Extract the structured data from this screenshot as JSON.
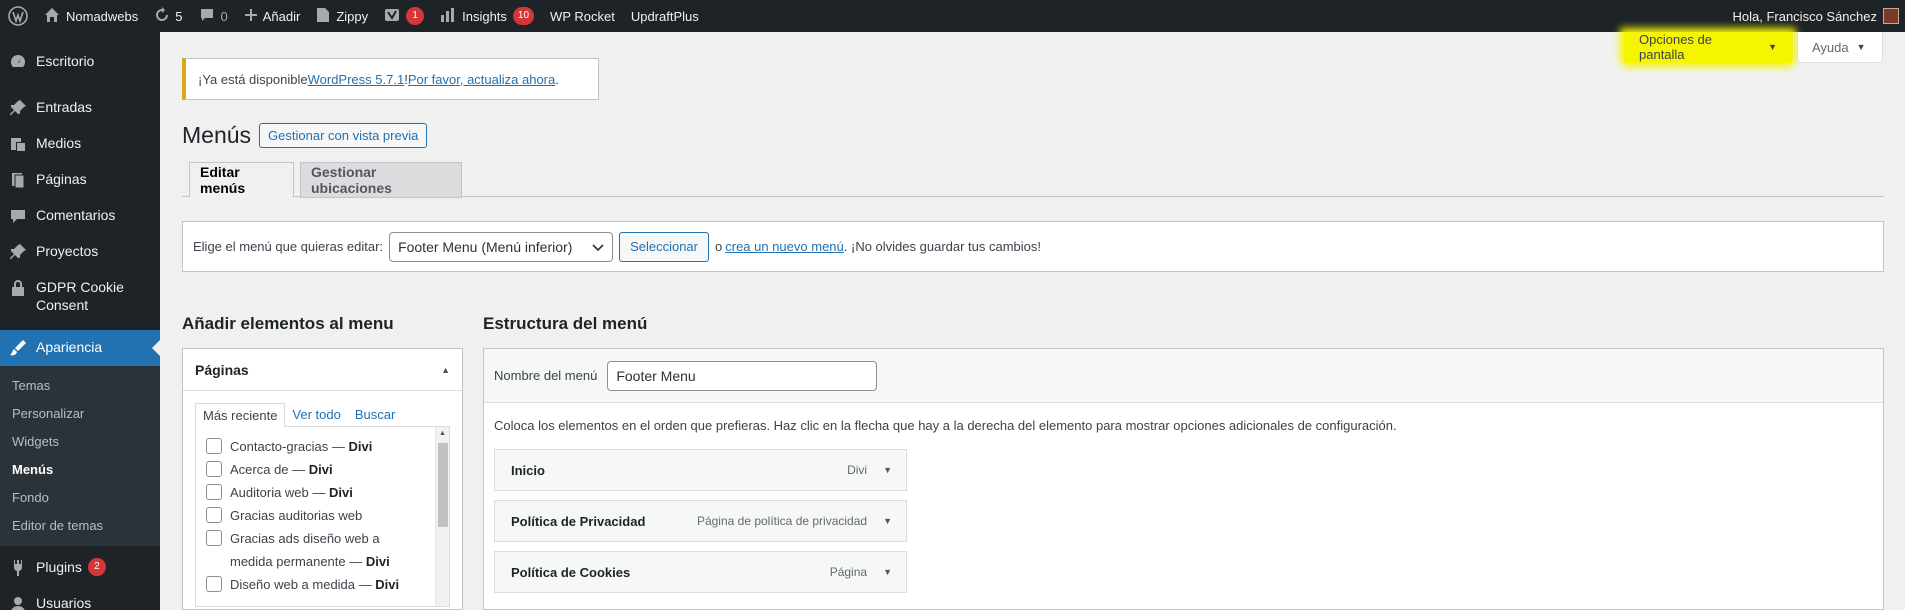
{
  "adminbar": {
    "site_name": "Nomadwebs",
    "updates_count": "5",
    "comments_count": "0",
    "add_new": "Añadir",
    "zippy": "Zippy",
    "yoast_count": "1",
    "insights": "Insights",
    "insights_count": "10",
    "wp_rocket": "WP Rocket",
    "updraftplus": "UpdraftPlus",
    "greeting": "Hola, Francisco Sánchez"
  },
  "sidebar": {
    "items": [
      {
        "label": "Escritorio",
        "icon": "dashboard-icon"
      },
      {
        "label": "Entradas",
        "icon": "pin-icon"
      },
      {
        "label": "Medios",
        "icon": "media-icon"
      },
      {
        "label": "Páginas",
        "icon": "page-icon"
      },
      {
        "label": "Comentarios",
        "icon": "comment-icon"
      },
      {
        "label": "Proyectos",
        "icon": "pin-icon"
      },
      {
        "label": "GDPR Cookie Consent",
        "icon": "lock-icon"
      },
      {
        "label": "Apariencia",
        "icon": "brush-icon"
      }
    ],
    "submenu": [
      "Temas",
      "Personalizar",
      "Widgets",
      "Menús",
      "Fondo",
      "Editor de temas"
    ],
    "plugins": {
      "label": "Plugins",
      "badge": "2"
    },
    "users": {
      "label": "Usuarios"
    }
  },
  "screen_meta": {
    "screen_options": "Opciones de pantalla",
    "help": "Ayuda"
  },
  "notice": {
    "prefix": "¡Ya está disponible ",
    "link_version": "WordPress 5.7.1",
    "middle": "! ",
    "link_update": "Por favor, actualiza ahora",
    "suffix": "."
  },
  "page": {
    "title": "Menús",
    "action": "Gestionar con vista previa",
    "tabs": [
      "Editar menús",
      "Gestionar ubicaciones"
    ]
  },
  "manage_menus": {
    "label": "Elige el menú que quieras editar:",
    "selected": "Footer Menu (Menú inferior)",
    "select_button": "Seleccionar",
    "or": "o",
    "create_link": "crea un nuevo menú",
    "reminder": ". ¡No olvides guardar tus cambios!"
  },
  "add_items": {
    "heading": "Añadir elementos al menu",
    "section_title": "Páginas",
    "tabs": [
      "Más reciente",
      "Ver todo",
      "Buscar"
    ],
    "pages": [
      {
        "title": "Contacto-gracias",
        "dash": " — ",
        "theme": "Divi"
      },
      {
        "title": "Acerca de",
        "dash": " — ",
        "theme": "Divi"
      },
      {
        "title": "Auditoria web",
        "dash": " — ",
        "theme": "Divi"
      },
      {
        "title": "Gracias auditorias web",
        "dash": "",
        "theme": ""
      },
      {
        "title": "Gracias ads diseño web a medida permanente",
        "dash": " — ",
        "theme": "Divi"
      },
      {
        "title": "Diseño web a medida",
        "dash": " — ",
        "theme": "Divi"
      }
    ]
  },
  "structure": {
    "heading": "Estructura del menú",
    "name_label": "Nombre del menú",
    "name_value": "Footer Menu",
    "instructions": "Coloca los elementos en el orden que prefieras. Haz clic en la flecha que hay a la derecha del elemento para mostrar opciones adicionales de configuración.",
    "items": [
      {
        "title": "Inicio",
        "type": "Divi"
      },
      {
        "title": "Política de Privacidad",
        "type": "Página de política de privacidad"
      },
      {
        "title": "Política de Cookies",
        "type": "Página"
      }
    ]
  },
  "colors": {
    "adminbar_bg": "#1d2327",
    "accent": "#2271b1",
    "badge": "#d63638",
    "highlight": "#f5f500"
  }
}
